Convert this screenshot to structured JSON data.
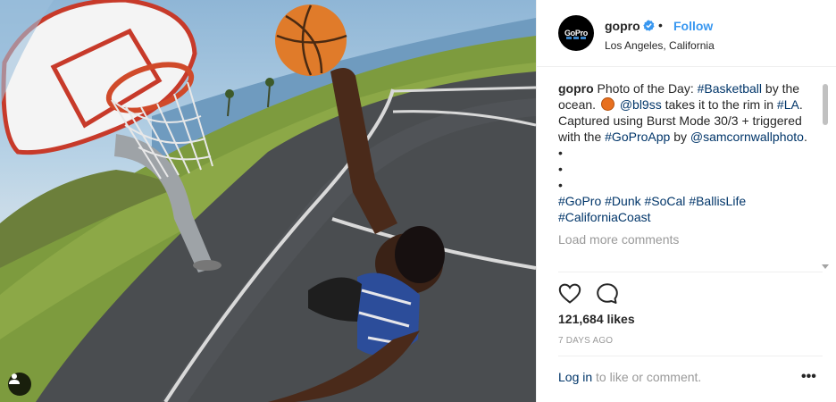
{
  "post": {
    "username": "gopro",
    "follow_label": "Follow",
    "separator": "•",
    "location": "Los Angeles, California",
    "avatar_text": "GoPro",
    "caption": {
      "author": "gopro",
      "t1": " Photo of the Day: ",
      "tag_basketball": "#Basketball",
      "t2": " by the ocean. ",
      "mention_bl9ss": "@bl9ss",
      "t3": " takes it to the rim in ",
      "tag_la": "#LA",
      "t4": ". Captured using Burst Mode 30/3 + triggered with the ",
      "tag_goproapp": "#GoProApp",
      "t5": " by ",
      "mention_sam": "@samcornwallphoto",
      "t6": ".",
      "bullet1": "•",
      "bullet2": "•",
      "bullet3": "•",
      "tag_gopro": "#GoPro",
      "tag_dunk": "#Dunk",
      "tag_socal": "#SoCal",
      "tag_ballislife": "#BallisLife",
      "tag_californiacoast": "#CaliforniaCoast"
    },
    "load_more": "Load more comments",
    "likes": "121,684 likes",
    "time_ago": "7 DAYS AGO",
    "login_link": "Log in",
    "login_rest": " to like or comment.",
    "more_options": "•••"
  },
  "colors": {
    "link": "#003569",
    "follow": "#3897f0",
    "muted": "#999999",
    "verified": "#3897f0"
  },
  "icons": {
    "like": "heart-icon",
    "comment": "comment-icon",
    "verified": "verified-badge-icon",
    "user_tag": "person-icon",
    "options": "more-options-icon"
  }
}
